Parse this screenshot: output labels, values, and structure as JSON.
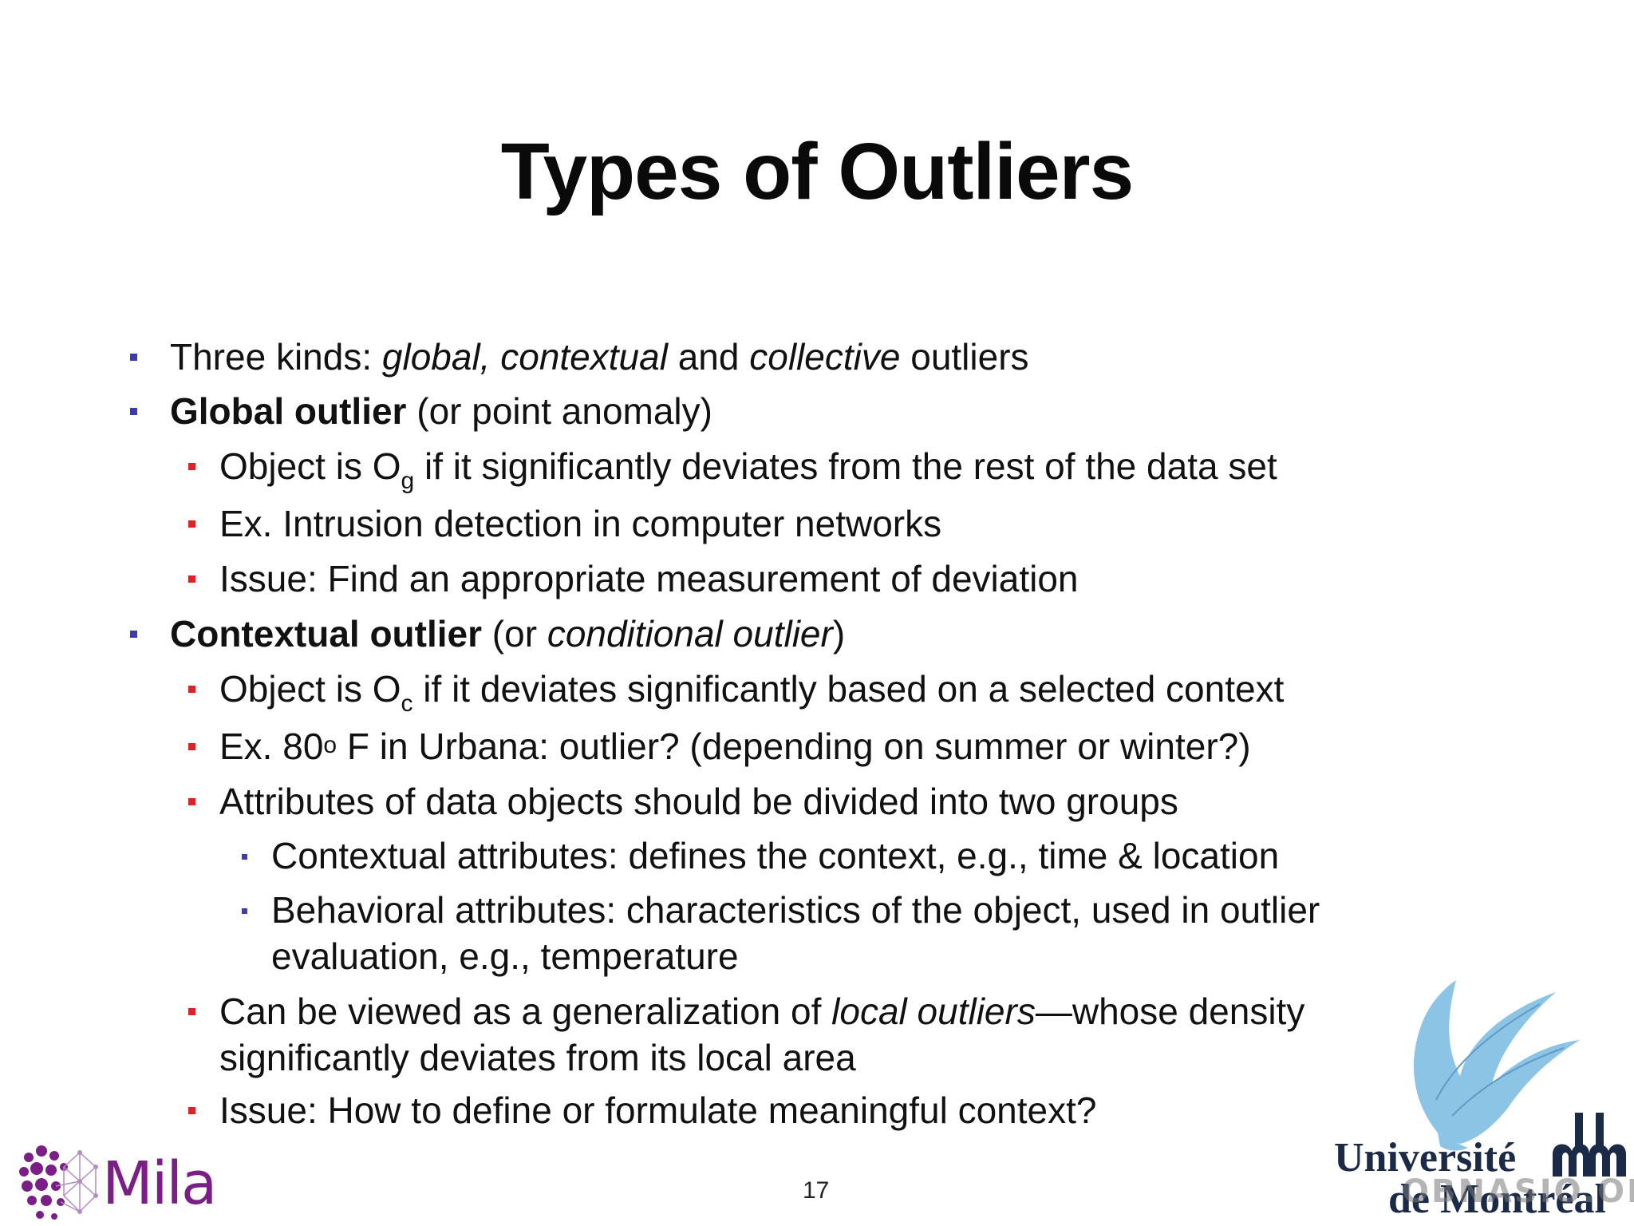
{
  "slide": {
    "title": "Types of Outliers",
    "page_number": "17"
  },
  "bullets": {
    "b1": {
      "prefix": "Three kinds: ",
      "it1": "global, contextual",
      "mid": " and ",
      "it2": "collective",
      "suffix": " outliers"
    },
    "b2": {
      "bold": "Global outlier",
      "rest": " (or point anomaly)"
    },
    "b2_1": {
      "pre": "Object is O",
      "sub": "g",
      "post": " if it significantly deviates from the rest of the data set"
    },
    "b2_2": "Ex. Intrusion detection in computer networks",
    "b2_3": "Issue: Find an appropriate measurement of deviation",
    "b3": {
      "bold": "Contextual outlier",
      "pre": " (or ",
      "ital": "conditional outlier",
      "post": ")"
    },
    "b3_1": {
      "pre": "Object is O",
      "sub": "c",
      "post": " if it deviates significantly based on a selected context"
    },
    "b3_2": {
      "pre": "Ex. 80",
      "sup": "o",
      "post": " F in Urbana: outlier? (depending on summer or winter?)"
    },
    "b3_3": "Attributes of data objects should be divided into two groups",
    "b3_3_1": "Contextual attributes: defines the context, e.g., time & location",
    "b3_3_2": {
      "line1": "Behavioral attributes:  characteristics of the object, used in outlier",
      "line2": "evaluation, e.g., temperature"
    },
    "b3_4": {
      "pre": "Can be viewed as a generalization of ",
      "ital": "local outliers",
      "post": "—whose density",
      "line2": "significantly deviates from its local area"
    },
    "b3_5": "Issue: How to define or formulate meaningful context?"
  },
  "logos": {
    "mila": "Mila",
    "udem_line1": "Université",
    "udem_line2": "de Montréal",
    "watermark": "OBNASIO.ORG"
  },
  "colors": {
    "bullet_level1": "#3b3bb3",
    "bullet_level2": "#d7262b",
    "mila_purple": "#7a1f86",
    "udem_blue": "#1b2a47",
    "udem_bird": "#8cc4e6"
  }
}
